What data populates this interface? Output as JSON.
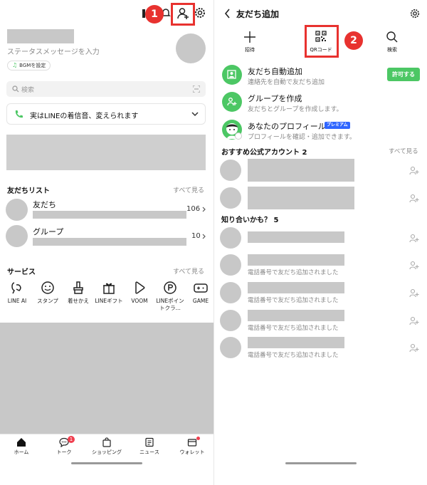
{
  "left": {
    "step": "1",
    "status_placeholder": "ステータスメッセージを入力",
    "bgm_label": "BGMを設定",
    "search_placeholder": "検索",
    "ringtone_banner": "実はLINEの着信音、変えられます",
    "friends_list": {
      "title": "友だちリスト",
      "see_all": "すべて見る",
      "items": [
        {
          "label": "友だち",
          "count": "106"
        },
        {
          "label": "グループ",
          "count": "10"
        }
      ]
    },
    "services": {
      "title": "サービス",
      "see_all": "すべて見る",
      "items": [
        {
          "label": "LINE AI",
          "icon": "line-ai-icon"
        },
        {
          "label": "スタンプ",
          "icon": "sticker-icon"
        },
        {
          "label": "着せかえ",
          "icon": "theme-brush-icon"
        },
        {
          "label": "LINEギフト",
          "icon": "gift-icon"
        },
        {
          "label": "VOOM",
          "icon": "voom-icon"
        },
        {
          "label": "LINEポイントクラ...",
          "icon": "points-icon"
        },
        {
          "label": "GAME",
          "icon": "game-icon"
        }
      ]
    },
    "bottom_nav": [
      {
        "label": "ホーム",
        "icon": "home-icon"
      },
      {
        "label": "トーク",
        "icon": "chat-icon",
        "badge": "1"
      },
      {
        "label": "ショッピング",
        "icon": "shopping-bag-icon"
      },
      {
        "label": "ニュース",
        "icon": "news-icon"
      },
      {
        "label": "ウォレット",
        "icon": "wallet-icon"
      }
    ]
  },
  "right": {
    "step": "2",
    "title": "友だち追加",
    "actions": [
      {
        "label": "招待",
        "icon": "plus-icon"
      },
      {
        "label": "QRコード",
        "icon": "qr-code-icon"
      },
      {
        "label": "検索",
        "icon": "search-icon"
      }
    ],
    "auto_add": {
      "title": "友だち自動追加",
      "subtitle": "連絡先を自動で友だち追加",
      "button": "許可する"
    },
    "create_group": {
      "title": "グループを作成",
      "subtitle": "友だちとグループを作成します。"
    },
    "profile": {
      "title": "あなたのプロフィール",
      "badge": "プレミアム",
      "subtitle": "プロフィールを確認・追加できます。"
    },
    "recommended": {
      "title": "おすすめ公式アカウント 2",
      "see_all": "すべて見る"
    },
    "know": {
      "title": "知り合いかも？ 5"
    },
    "phone_added_note": "電話番号で友だち追加されました"
  },
  "colors": {
    "line_green": "#4cc764",
    "annotation_red": "#e8322f",
    "premium_blue": "#2f66ff",
    "placeholder_gray": "#c8c8c8"
  }
}
